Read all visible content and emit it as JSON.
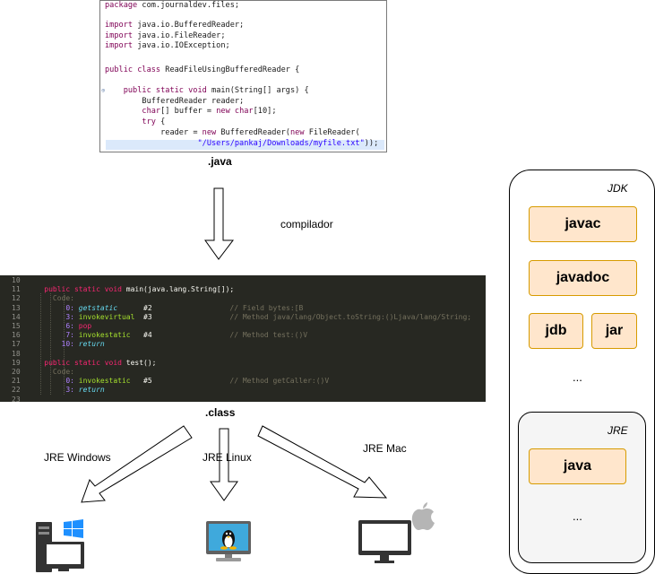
{
  "java_code": {
    "lines": [
      {
        "parts": [
          {
            "c": "kw",
            "t": "package"
          },
          {
            "c": "ty",
            "t": " com.journaldev.files;"
          }
        ]
      },
      {
        "parts": []
      },
      {
        "parts": [
          {
            "c": "kw",
            "t": "import"
          },
          {
            "c": "ty",
            "t": " java.io.BufferedReader;"
          }
        ]
      },
      {
        "parts": [
          {
            "c": "kw",
            "t": "import"
          },
          {
            "c": "ty",
            "t": " java.io.FileReader;"
          }
        ]
      },
      {
        "parts": [
          {
            "c": "kw",
            "t": "import"
          },
          {
            "c": "ty",
            "t": " java.io.IOException;"
          }
        ]
      },
      {
        "parts": []
      },
      {
        "parts": [
          {
            "c": "kw",
            "t": "public class"
          },
          {
            "c": "ty",
            "t": " ReadFileUsingBufferedReader {"
          }
        ]
      },
      {
        "parts": []
      },
      {
        "parts": [
          {
            "c": "ty",
            "t": "    "
          },
          {
            "c": "kw",
            "t": "public static void"
          },
          {
            "c": "ty",
            "t": " main(String[] "
          },
          {
            "c": "var",
            "t": "args"
          },
          {
            "c": "ty",
            "t": ") {"
          }
        ]
      },
      {
        "parts": [
          {
            "c": "ty",
            "t": "        BufferedReader "
          },
          {
            "c": "var",
            "t": "reader"
          },
          {
            "c": "ty",
            "t": ";"
          }
        ]
      },
      {
        "parts": [
          {
            "c": "ty",
            "t": "        "
          },
          {
            "c": "kw",
            "t": "char"
          },
          {
            "c": "ty",
            "t": "[] "
          },
          {
            "c": "var",
            "t": "buffer"
          },
          {
            "c": "ty",
            "t": " = "
          },
          {
            "c": "kw",
            "t": "new char"
          },
          {
            "c": "ty",
            "t": "[10];"
          }
        ]
      },
      {
        "parts": [
          {
            "c": "ty",
            "t": "        "
          },
          {
            "c": "kw",
            "t": "try"
          },
          {
            "c": "ty",
            "t": " {"
          }
        ]
      },
      {
        "parts": [
          {
            "c": "ty",
            "t": "            "
          },
          {
            "c": "var",
            "t": "reader"
          },
          {
            "c": "ty",
            "t": " = "
          },
          {
            "c": "kw",
            "t": "new"
          },
          {
            "c": "ty",
            "t": " BufferedReader("
          },
          {
            "c": "kw",
            "t": "new"
          },
          {
            "c": "ty",
            "t": " FileReader("
          }
        ]
      },
      {
        "parts": [
          {
            "c": "ty",
            "t": "                    "
          },
          {
            "c": "str",
            "t": "\"/Users/pankaj/Downloads/myfile.txt\""
          },
          {
            "c": "ty",
            "t": "));"
          }
        ]
      }
    ]
  },
  "java_caption": ".java",
  "compiler_label": "compilador",
  "class_code": {
    "lines": [
      {
        "n": "10",
        "parts": []
      },
      {
        "n": "11",
        "parts": [
          {
            "c": "kw2",
            "t": "    public static void"
          },
          {
            "c": "op2",
            "t": " main(java.lang.String[]);"
          }
        ]
      },
      {
        "n": "12",
        "parts": [
          {
            "c": "cm2",
            "t": "      Code:"
          }
        ]
      },
      {
        "n": "13",
        "parts": [
          {
            "c": "off2",
            "t": "         0: "
          },
          {
            "c": "it2",
            "t": "getstatic"
          },
          {
            "c": "op2",
            "t": "      #2                  "
          },
          {
            "c": "cm2",
            "t": "// Field bytes:[B"
          }
        ]
      },
      {
        "n": "14",
        "parts": [
          {
            "c": "off2",
            "t": "         3: "
          },
          {
            "c": "fn2",
            "t": "invokevirtual"
          },
          {
            "c": "op2",
            "t": "  #3                  "
          },
          {
            "c": "cm2",
            "t": "// Method java/lang/Object.toString:()Ljava/lang/String;"
          }
        ]
      },
      {
        "n": "15",
        "parts": [
          {
            "c": "off2",
            "t": "         6: "
          },
          {
            "c": "kw2",
            "t": "pop"
          }
        ]
      },
      {
        "n": "16",
        "parts": [
          {
            "c": "off2",
            "t": "         7: "
          },
          {
            "c": "fn2",
            "t": "invokestatic"
          },
          {
            "c": "op2",
            "t": "   #4                  "
          },
          {
            "c": "cm2",
            "t": "// Method test:()V"
          }
        ]
      },
      {
        "n": "17",
        "parts": [
          {
            "c": "off2",
            "t": "        10: "
          },
          {
            "c": "it2",
            "t": "return"
          }
        ]
      },
      {
        "n": "18",
        "parts": []
      },
      {
        "n": "19",
        "parts": [
          {
            "c": "kw2",
            "t": "    public static void"
          },
          {
            "c": "op2",
            "t": " test();"
          }
        ]
      },
      {
        "n": "20",
        "parts": [
          {
            "c": "cm2",
            "t": "      Code:"
          }
        ]
      },
      {
        "n": "21",
        "parts": [
          {
            "c": "off2",
            "t": "         0: "
          },
          {
            "c": "fn2",
            "t": "invokestatic"
          },
          {
            "c": "op2",
            "t": "   #5                  "
          },
          {
            "c": "cm2",
            "t": "// Method getCaller:()V"
          }
        ]
      },
      {
        "n": "22",
        "parts": [
          {
            "c": "off2",
            "t": "         3: "
          },
          {
            "c": "it2",
            "t": "return"
          }
        ]
      },
      {
        "n": "23",
        "parts": []
      }
    ]
  },
  "class_caption": ".class",
  "jre_windows_label": "JRE Windows",
  "jre_linux_label": "JRE Linux",
  "jre_mac_label": "JRE Mac",
  "icons": [
    "windows-pc-icon",
    "linux-monitor-icon",
    "mac-monitor-icon"
  ],
  "jdk": {
    "title": "JDK",
    "tools": [
      "javac",
      "javadoc",
      "jdb",
      "jar"
    ],
    "ellipsis": "...",
    "jre": {
      "title": "JRE",
      "tool": "java",
      "ellipsis": "..."
    }
  },
  "colors": {
    "tool_fill": "#ffe6cc",
    "tool_border": "#d79b00",
    "jre_fill": "#f5f5f5",
    "code_bg": "#272822"
  }
}
